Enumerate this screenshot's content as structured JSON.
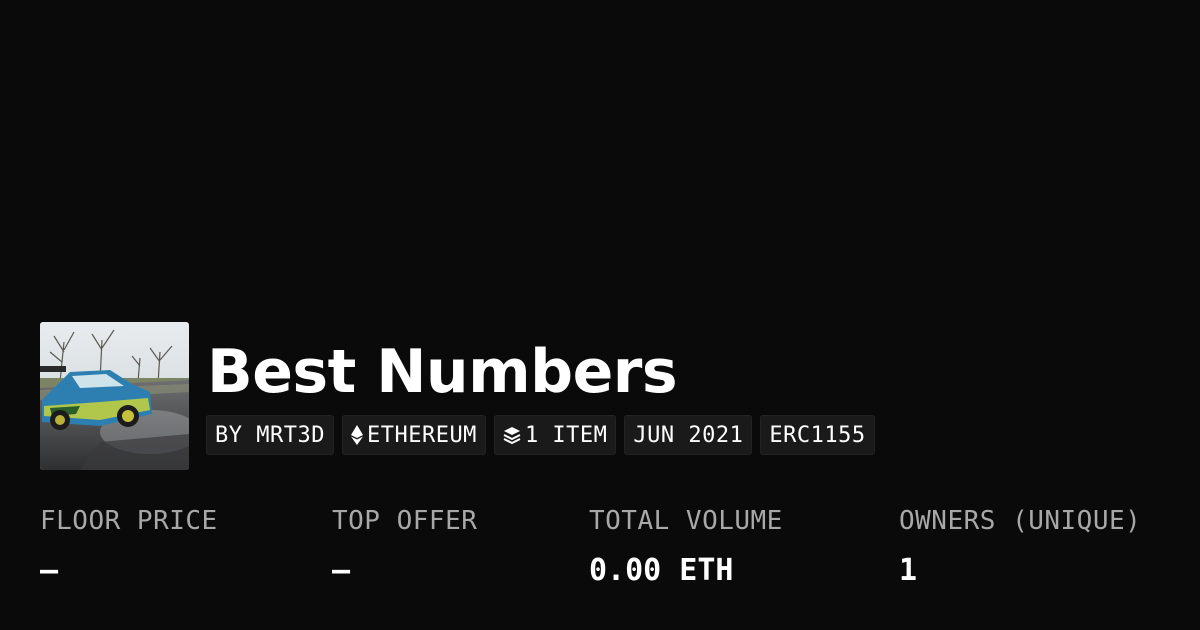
{
  "collection": {
    "title": "Best Numbers",
    "image_alt": "drifting car"
  },
  "tags": {
    "creator": "BY MRT3D",
    "chain": "ETHEREUM",
    "items": "1 ITEM",
    "date": "JUN 2021",
    "standard": "ERC1155"
  },
  "icons": {
    "chain": "ethereum-icon",
    "items": "layers-icon"
  },
  "stats": [
    {
      "label": "FLOOR PRICE",
      "value": "—"
    },
    {
      "label": "TOP OFFER",
      "value": "—"
    },
    {
      "label": "TOTAL VOLUME",
      "value": "0.00 ETH"
    },
    {
      "label": "OWNERS (UNIQUE)",
      "value": "1"
    }
  ],
  "colors": {
    "background": "#0a0a0a",
    "tag_background": "#1a1a1a",
    "label": "#a8a8a8",
    "text": "#ffffff"
  }
}
